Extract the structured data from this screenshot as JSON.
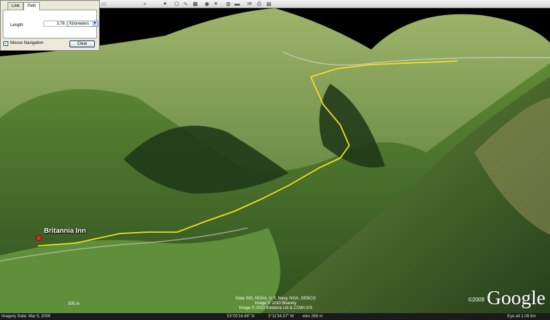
{
  "ruler": {
    "tabs": [
      {
        "label": "Line",
        "active": false
      },
      {
        "label": "Path",
        "active": true
      }
    ],
    "length_label": "Length:",
    "length_value": "3.76",
    "unit": "Kilometers",
    "mouse_nav_label": "Mouse Navigation",
    "mouse_nav_checked": true,
    "clear_label": "Clear"
  },
  "map": {
    "place_label": "Britannia Inn",
    "scale_label": "505 m",
    "credits": [
      "Data SIO, NOAA, U.S. Navy, NGA, GEBCO",
      "Image © 2010 Bluesky",
      "Image © 2010 Infoterra Ltd & COWI A/S"
    ],
    "copyright": "©2009",
    "logo": "Google",
    "path_color": "#f3e21c"
  },
  "statusbar": {
    "imagery_date": "Imagery Date: Mar 5, 2006",
    "lat": "53°00'16.66\" N",
    "lon": "3°11'34.57\" W",
    "elev": "elev  268 m",
    "eye_alt": "Eye alt  1.08 km"
  }
}
